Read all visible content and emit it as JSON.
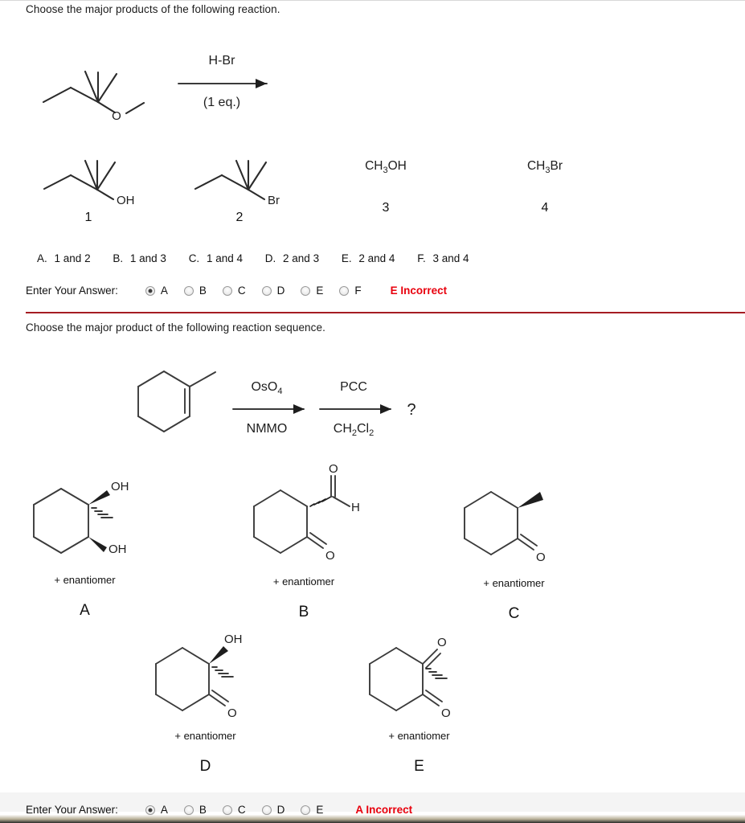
{
  "questions": [
    {
      "id": "q1",
      "prompt": "Choose the major products of the following reaction.",
      "reaction": {
        "reagent_top": "H-Br",
        "reagent_bottom": "(1 eq.)",
        "substrate_name": "2-methoxy-2-methylbutane"
      },
      "products": [
        {
          "number": "1",
          "name": "2-methyl-2-butanol",
          "label": "OH"
        },
        {
          "number": "2",
          "name": "2-bromo-2-methylbutane",
          "label": "Br"
        },
        {
          "number": "3",
          "name": "methanol",
          "formula_parts": [
            "CH",
            "3",
            "OH"
          ]
        },
        {
          "number": "4",
          "name": "bromomethane",
          "formula_parts": [
            "CH",
            "3",
            "Br"
          ]
        }
      ],
      "choices": [
        {
          "letter": "A.",
          "text": "1 and 2"
        },
        {
          "letter": "B.",
          "text": "1 and 3"
        },
        {
          "letter": "C.",
          "text": "1 and 4"
        },
        {
          "letter": "D.",
          "text": "2 and 3"
        },
        {
          "letter": "E.",
          "text": "2 and 4"
        },
        {
          "letter": "F.",
          "text": "3 and 4"
        }
      ],
      "answer_row": {
        "label": "Enter Your Answer:",
        "radios": [
          "A",
          "B",
          "C",
          "D",
          "E",
          "F"
        ],
        "selected": "A",
        "verdict": "E Incorrect",
        "verdict_color": "#e8000d"
      }
    },
    {
      "id": "q2",
      "prompt": "Choose the major product of the following reaction sequence.",
      "reaction": {
        "substrate_name": "1-methylcyclohexene",
        "step1_top": "OsO",
        "step1_top_sub": "4",
        "step1_bottom": "NMMO",
        "step2_top": "PCC",
        "step2_bottom_parts": [
          "CH",
          "2",
          "Cl",
          "2"
        ],
        "question_mark": "?"
      },
      "structures": [
        {
          "letter": "A",
          "enantiomer": "+ enantiomer",
          "name": "1-methylcyclohexane-1,2-diol",
          "labels": [
            "OH",
            "OH"
          ]
        },
        {
          "letter": "B",
          "enantiomer": "+ enantiomer",
          "name": "2-oxocyclohexanecarbaldehyde",
          "labels": [
            "O",
            "H",
            "O"
          ]
        },
        {
          "letter": "C",
          "enantiomer": "+ enantiomer",
          "name": "2-methylcyclohexanone",
          "labels": [
            "O"
          ]
        },
        {
          "letter": "D",
          "enantiomer": "+ enantiomer",
          "name": "2-hydroxy-2-methylcyclohexanone",
          "labels": [
            "OH",
            "O"
          ]
        },
        {
          "letter": "E",
          "enantiomer": "+ enantiomer",
          "name": "2-methylcyclohexane-1,2-dione",
          "labels": [
            "O",
            "O"
          ]
        }
      ],
      "answer_row": {
        "label": "Enter Your Answer:",
        "radios": [
          "A",
          "B",
          "C",
          "D",
          "E"
        ],
        "selected": "A",
        "verdict": "A Incorrect",
        "verdict_color": "#e8000d"
      }
    }
  ]
}
